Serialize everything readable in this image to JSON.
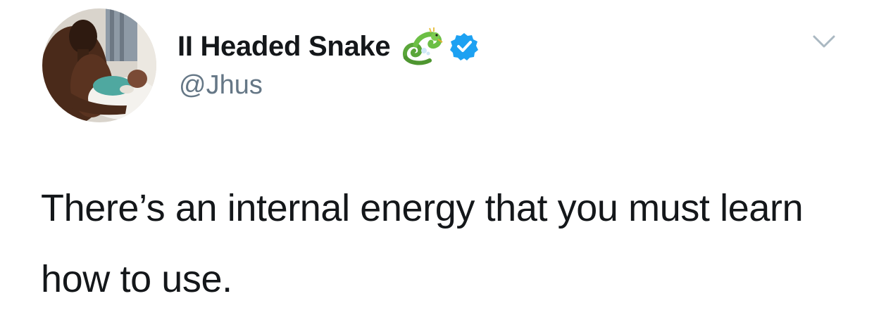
{
  "tweet": {
    "author": {
      "display_name": "II Headed Snake",
      "handle": "@Jhus",
      "name_emoji_icon": "dragon-icon",
      "verified_icon": "verified-badge-icon",
      "verified_color": "#1da1f2"
    },
    "text": "There’s an internal energy that you must learn how to use.",
    "menu_icon": "chevron-down-icon"
  },
  "colors": {
    "text_primary": "#14171a",
    "text_secondary": "#657786",
    "caret": "#aab8c2",
    "background": "#ffffff"
  }
}
